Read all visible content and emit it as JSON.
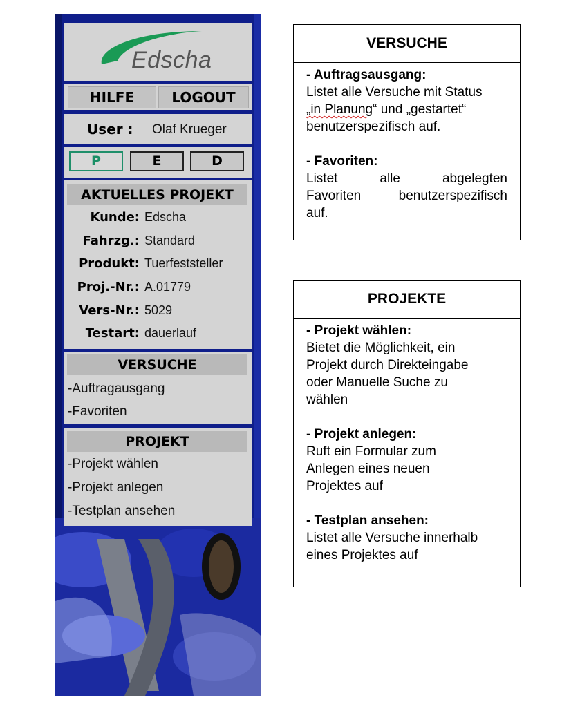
{
  "sidebar": {
    "logo_text": "Edscha",
    "nav": {
      "help_label": "HILFE",
      "logout_label": "LOGOUT"
    },
    "user": {
      "label": "User :",
      "name": "Olaf Krueger"
    },
    "modes": {
      "p_label": "P",
      "e_label": "E",
      "d_label": "D",
      "active": "P"
    },
    "current_project": {
      "title": "AKTUELLES PROJEKT",
      "fields": [
        {
          "label": "Kunde:",
          "value": "Edscha"
        },
        {
          "label": "Fahrzg.:",
          "value": "Standard"
        },
        {
          "label": "Produkt:",
          "value": "Tuerfeststeller"
        },
        {
          "label": "Proj.-Nr.:",
          "value": "A.01779"
        },
        {
          "label": "Vers-Nr.:",
          "value": "5029"
        },
        {
          "label": "Testart:",
          "value": "dauerlauf"
        }
      ]
    },
    "versuche": {
      "title": "VERSUCHE",
      "items": [
        "-Auftragausgang",
        "-Favoriten"
      ]
    },
    "projekt": {
      "title": "PROJEKT",
      "items": [
        "-Projekt wählen",
        "-Projekt anlegen",
        "-Testplan ansehen"
      ]
    }
  },
  "info": {
    "versuche": {
      "title": "VERSUCHE",
      "s1_head": "-  Auftragsausgang:",
      "s1_line1": "Listet alle Versuche mit Status",
      "s1_line2a": "„in  Planung",
      "s1_line2b": "“ und „gestartet“",
      "s1_line3": "benutzerspezifisch auf.",
      "s2_head": "- Favoriten:",
      "s2_line1": "Listet          alle          abgelegten",
      "s2_line2": "Favoriten     benutzerspezifisch",
      "s2_line3": "auf."
    },
    "projekte": {
      "title": "PROJEKTE",
      "s1_head": "- Projekt wählen:",
      "s1_lines": [
        "Bietet die Möglichkeit, ein",
        "Projekt durch Direkteingabe",
        "oder Manuelle Suche zu",
        "wählen"
      ],
      "s2_head": "- Projekt anlegen:",
      "s2_lines": [
        "Ruft ein Formular zum",
        "Anlegen eines neuen",
        "Projektes auf"
      ],
      "s3_head": "- Testplan ansehen:",
      "s3_lines": [
        "Listet alle Versuche innerhalb",
        "eines Projektes auf"
      ]
    }
  },
  "colors": {
    "sidebar_blue": "#13239a",
    "panel_gray": "#d4d4d4",
    "logo_green": "#1a9a55",
    "active_mode": "#1f8f6a"
  }
}
